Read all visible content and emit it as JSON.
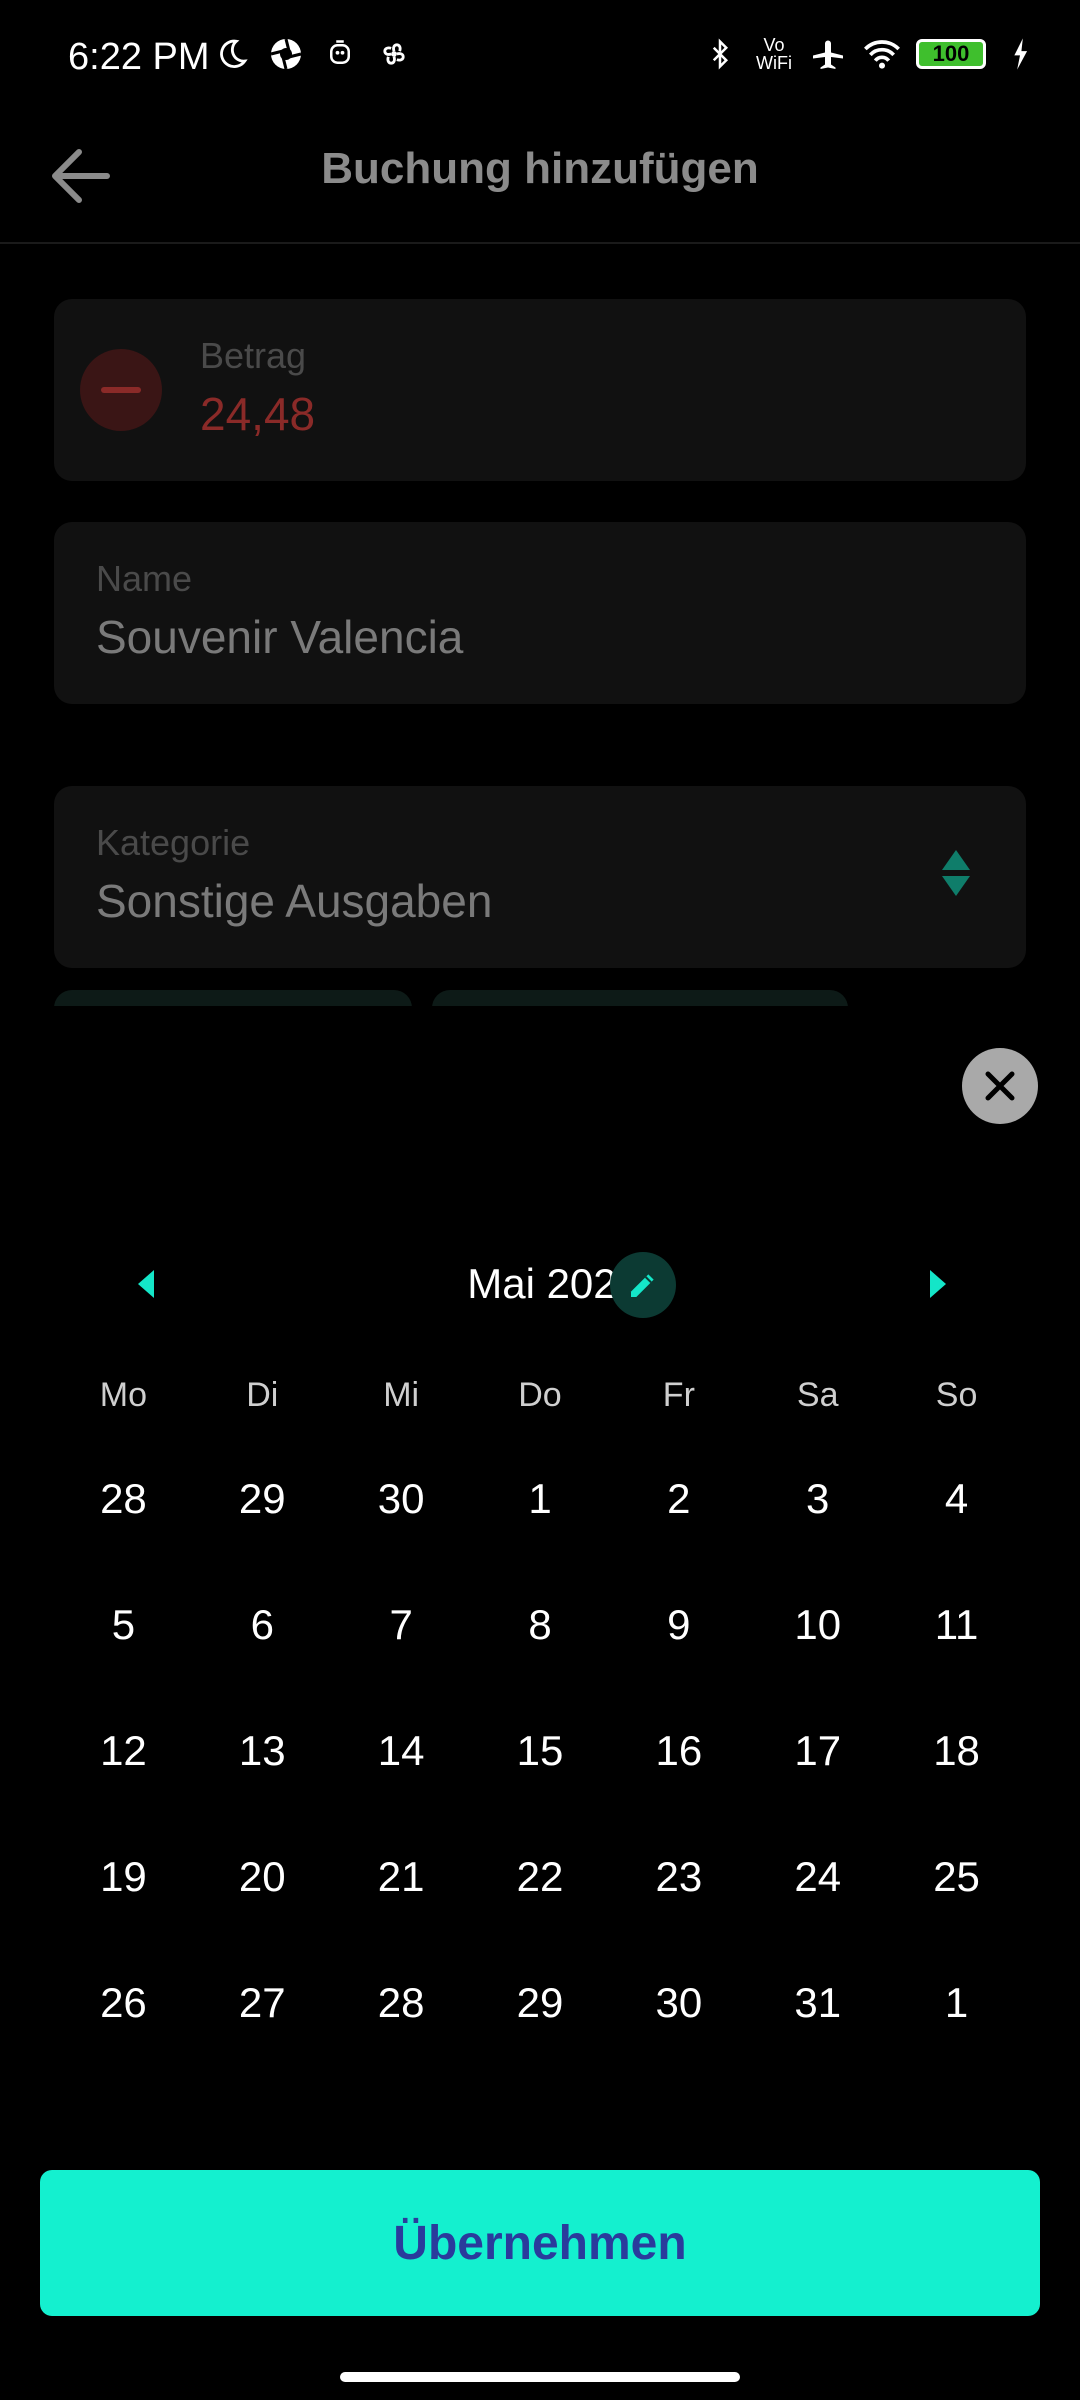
{
  "status_bar": {
    "time": "6:22 PM",
    "vo_wifi": "Vo\nWiFi",
    "battery": "100",
    "left_icons": [
      "moon-icon",
      "camera-shutter-icon",
      "notification-icon",
      "fan-icon"
    ],
    "right_icons": [
      "bluetooth-icon",
      "vowifi-icon",
      "airplane-icon",
      "wifi-icon",
      "battery-icon",
      "charging-icon"
    ]
  },
  "header": {
    "title": "Buchung hinzufügen",
    "back_icon": "arrow-left-icon"
  },
  "form": {
    "amount": {
      "label": "Betrag",
      "value": "24,48",
      "sign_icon": "minus-icon"
    },
    "name": {
      "label": "Name",
      "value": "Souvenir Valencia"
    },
    "category": {
      "label": "Kategorie",
      "value": "Sonstige Ausgaben",
      "icon": "sort-arrows-icon"
    }
  },
  "date_picker": {
    "close_icon": "close-icon",
    "month_label": "Mai 2025",
    "prev_icon": "triangle-left-icon",
    "next_icon": "triangle-right-icon",
    "edit_icon": "pencil-icon",
    "weekdays": [
      "Mo",
      "Di",
      "Mi",
      "Do",
      "Fr",
      "Sa",
      "So"
    ],
    "days": [
      "28",
      "29",
      "30",
      "1",
      "2",
      "3",
      "4",
      "5",
      "6",
      "7",
      "8",
      "9",
      "10",
      "11",
      "12",
      "13",
      "14",
      "15",
      "16",
      "17",
      "18",
      "19",
      "20",
      "21",
      "22",
      "23",
      "24",
      "25",
      "26",
      "27",
      "28",
      "29",
      "30",
      "31",
      "1"
    ]
  },
  "actions": {
    "apply_label": "Übernehmen"
  },
  "colors": {
    "accent": "#14f0cf",
    "accent_dark": "#0c3a33",
    "button_text": "#2a3b9c",
    "amount_negative": "#8a2a28",
    "background": "#000000",
    "card": "#111111"
  }
}
